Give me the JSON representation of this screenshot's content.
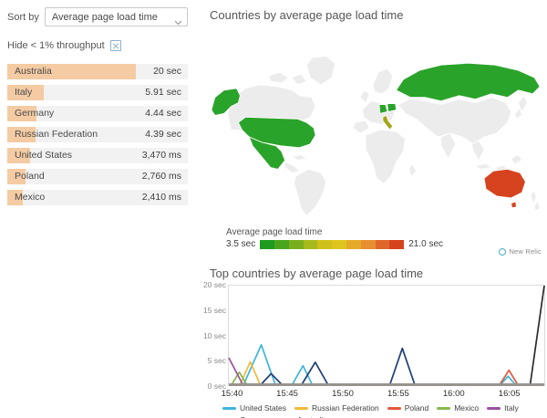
{
  "sidebar": {
    "sort_label": "Sort by",
    "sort_value": "Average page load time",
    "hide_label": "Hide < 1% throughput",
    "bar_color": "#f4cba3",
    "countries": [
      {
        "name": "Australia",
        "value": "20 sec",
        "bar_pct": 71
      },
      {
        "name": "Italy",
        "value": "5.91 sec",
        "bar_pct": 20
      },
      {
        "name": "Germany",
        "value": "4.44 sec",
        "bar_pct": 16
      },
      {
        "name": "Russian Federation",
        "value": "4.39 sec",
        "bar_pct": 15.5
      },
      {
        "name": "United States",
        "value": "3,470 ms",
        "bar_pct": 12.5
      },
      {
        "name": "Poland",
        "value": "2,760 ms",
        "bar_pct": 10
      },
      {
        "name": "Mexico",
        "value": "2,410 ms",
        "bar_pct": 8.7
      }
    ]
  },
  "map_section": {
    "title": "Countries by average page load time",
    "legend_title": "Average page load time",
    "legend_min": "3.5 sec",
    "legend_max": "21.0 sec",
    "gradient": [
      "#1e9b1e",
      "#4aa51d",
      "#79af1c",
      "#a7b91b",
      "#d0c11a",
      "#e0c41e",
      "#e5aa28",
      "#e78f31",
      "#e0672a",
      "#d6431c"
    ],
    "country_colors": {
      "green": "#2aa32a",
      "olive": "#a5a419",
      "red": "#d6431f",
      "base": "#ececec"
    }
  },
  "branding": {
    "logo_text": "New Relic"
  },
  "chart_data": {
    "type": "line",
    "title": "Top countries by average page load time",
    "unit": "sec",
    "ylim": [
      0,
      20
    ],
    "yticks_top_down": [
      "20 sec",
      "15 sec",
      "10 sec",
      "5 sec",
      "0 sec"
    ],
    "xticks": [
      {
        "label": "15:40",
        "pos": 0.013
      },
      {
        "label": "15:45",
        "pos": 0.187
      },
      {
        "label": "15:50",
        "pos": 0.362
      },
      {
        "label": "15:55",
        "pos": 0.537
      },
      {
        "label": "16:00",
        "pos": 0.712
      },
      {
        "label": "16:05",
        "pos": 0.887
      }
    ],
    "series": [
      {
        "name": "United States",
        "color": "#3db5dc",
        "points": [
          [
            0,
            0
          ],
          [
            0.046,
            0
          ],
          [
            0.103,
            8.1
          ],
          [
            0.148,
            0
          ],
          [
            0.2,
            0
          ],
          [
            0.235,
            3.9
          ],
          [
            0.265,
            0
          ],
          [
            0.86,
            0
          ],
          [
            0.885,
            1.8
          ],
          [
            0.91,
            0
          ],
          [
            1,
            0
          ]
        ]
      },
      {
        "name": "Russian Federation",
        "color": "#f0b83c",
        "points": [
          [
            0,
            0
          ],
          [
            0.035,
            0
          ],
          [
            0.068,
            4.7
          ],
          [
            0.1,
            0
          ],
          [
            1,
            0
          ]
        ]
      },
      {
        "name": "Poland",
        "color": "#e4573d",
        "points": [
          [
            0,
            0
          ],
          [
            0.858,
            0
          ],
          [
            0.888,
            3.0
          ],
          [
            0.917,
            0
          ],
          [
            1,
            0
          ]
        ]
      },
      {
        "name": "Mexico",
        "color": "#86b94d",
        "points": [
          [
            0,
            0
          ],
          [
            0.008,
            0
          ],
          [
            0.033,
            2.6
          ],
          [
            0.058,
            0
          ],
          [
            1,
            0
          ]
        ]
      },
      {
        "name": "Italy",
        "color": "#9b4fa0",
        "points": [
          [
            0,
            5.5
          ],
          [
            0.045,
            0
          ],
          [
            1,
            0
          ]
        ]
      },
      {
        "name": "Germany",
        "color": "#1f3d7a",
        "points": [
          [
            0,
            0
          ],
          [
            0.1,
            0
          ],
          [
            0.134,
            2.3
          ],
          [
            0.17,
            0
          ],
          [
            0.23,
            0
          ],
          [
            0.274,
            4.6
          ],
          [
            0.315,
            0
          ],
          [
            0.51,
            0
          ],
          [
            0.55,
            7.4
          ],
          [
            0.59,
            0
          ],
          [
            1,
            0
          ]
        ]
      },
      {
        "name": "Australia",
        "color": "#2b2b2b",
        "points": [
          [
            0,
            0
          ],
          [
            0.955,
            0
          ],
          [
            1,
            20
          ]
        ]
      }
    ],
    "legend_position": "bottom"
  }
}
